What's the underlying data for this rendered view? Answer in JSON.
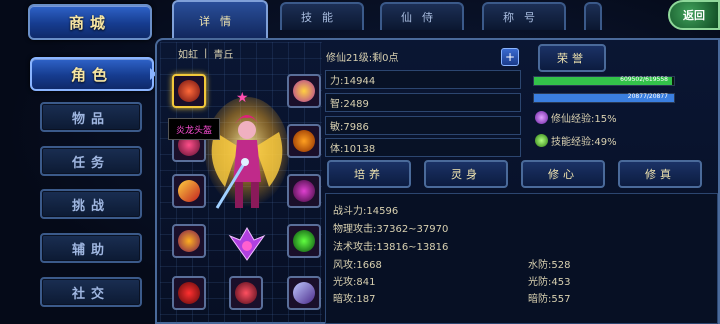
{
  "left_menu": {
    "shop": "商城",
    "role": "角色",
    "items": [
      "物品",
      "任务",
      "挑战",
      "辅助",
      "社交"
    ]
  },
  "tabs": [
    "详情",
    "技能",
    "仙侍",
    "称号",
    ""
  ],
  "back_label": "返回",
  "character": {
    "name": "如虹",
    "divider": "|",
    "realm": "青丘",
    "equip_tooltip": "炎龙头盔"
  },
  "level_info": "修仙21级:剩0点",
  "honor_button": "荣誉",
  "plus_button": "+",
  "bars": [
    {
      "label": "609502/619558",
      "fraction": 0.984,
      "color": "#33c24a"
    },
    {
      "label": "20877/20877",
      "fraction": 1.0,
      "color": "#3b7fe0"
    }
  ],
  "exp": {
    "xiuxian": "修仙经验:15%",
    "skill": "技能经验:49%"
  },
  "stats": [
    "力:14944",
    "智:2489",
    "敏:7986",
    "体:10138"
  ],
  "sub_buttons": [
    "培养",
    "灵身",
    "修心",
    "修真"
  ],
  "details_left": [
    "战斗力:14596",
    "物理攻击:37362~37970",
    "法术攻击:13816~13816",
    "风攻:1668",
    "光攻:841",
    "暗攻:187"
  ],
  "details_right": [
    "水防:528",
    "光防:453",
    "暗防:557"
  ]
}
